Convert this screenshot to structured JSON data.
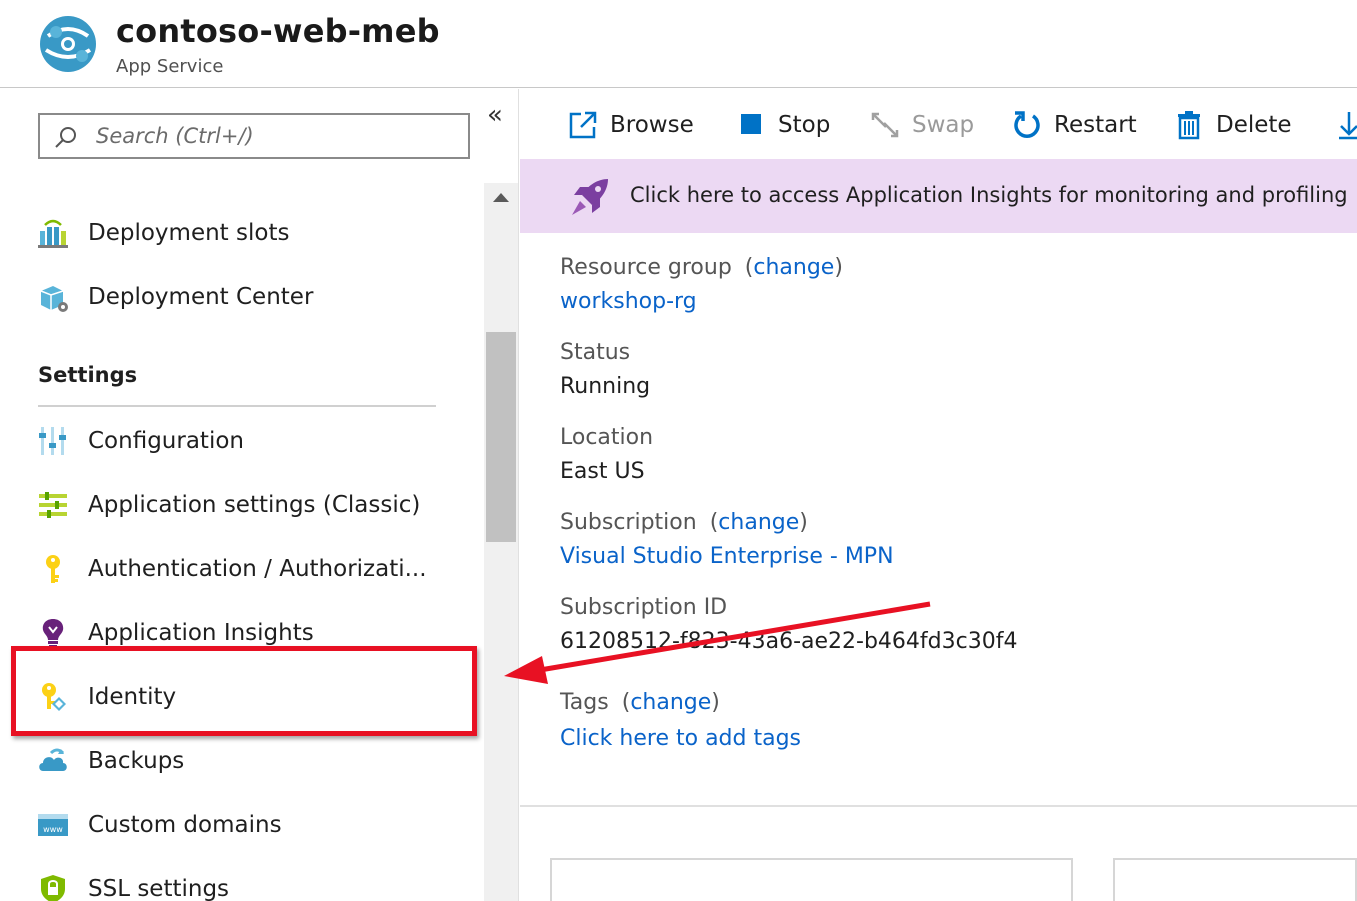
{
  "header": {
    "title": "contoso-web-meb",
    "subtitle": "App Service",
    "logo_icon": "app-service-icon"
  },
  "sidebar": {
    "search_placeholder": "Search (Ctrl+/)",
    "collapse_glyph": "«",
    "items_top": [
      {
        "label": "Deployment slots",
        "icon": "deployment-slots-icon"
      },
      {
        "label": "Deployment Center",
        "icon": "deployment-center-icon"
      }
    ],
    "section_title": "Settings",
    "settings_items": [
      {
        "label": "Configuration",
        "icon": "configuration-icon"
      },
      {
        "label": "Application settings (Classic)",
        "icon": "application-settings-icon"
      },
      {
        "label": "Authentication / Authorizati...",
        "icon": "key-icon"
      },
      {
        "label": "Application Insights",
        "icon": "lightbulb-icon"
      },
      {
        "label": "Identity",
        "icon": "identity-key-icon"
      },
      {
        "label": "Backups",
        "icon": "cloud-backup-icon"
      },
      {
        "label": "Custom domains",
        "icon": "www-icon"
      },
      {
        "label": "SSL settings",
        "icon": "shield-icon"
      }
    ]
  },
  "toolbar": {
    "browse": "Browse",
    "stop": "Stop",
    "swap": "Swap",
    "restart": "Restart",
    "delete": "Delete"
  },
  "banner": {
    "text": "Click here to access Application Insights for monitoring and profiling",
    "icon": "rocket-icon"
  },
  "essentials": {
    "resource_group_label": "Resource group",
    "resource_group_value": "workshop-rg",
    "status_label": "Status",
    "status_value": "Running",
    "location_label": "Location",
    "location_value": "East US",
    "subscription_label": "Subscription",
    "subscription_value": "Visual Studio Enterprise - MPN",
    "subscription_id_label": "Subscription ID",
    "subscription_id_value": "61208512-f823-43a6-ae22-b464fd3c30f4",
    "tags_label": "Tags",
    "tags_value": "Click here to add tags",
    "change_link": "change",
    "paren_open": "(",
    "paren_close": ")"
  },
  "colors": {
    "highlight": "#e81123",
    "link": "#0a63c9",
    "banner_bg": "#ecd9f3",
    "accent_blue": "#0072c6"
  }
}
